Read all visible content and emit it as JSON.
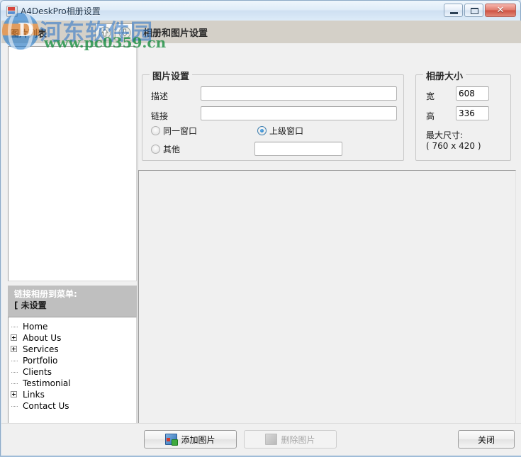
{
  "window": {
    "title": "A4DeskPro相册设置",
    "icon": "app-icon",
    "controls": {
      "minimize": "minimize-icon",
      "maximize": "maximize-icon",
      "close": "✕"
    }
  },
  "toolbar": {
    "left_panel_label": "图片列表",
    "move_up": "arrow-up-icon",
    "move_down": "arrow-down-icon",
    "right_panel_label": "相册和图片设置"
  },
  "left": {
    "image_list_items": [],
    "menu_header": {
      "line1": "链接相册到菜单:",
      "line2": "[ 未设置"
    },
    "tree": [
      {
        "label": "Home",
        "expandable": false
      },
      {
        "label": "About Us",
        "expandable": true
      },
      {
        "label": "Services",
        "expandable": true
      },
      {
        "label": "Portfolio",
        "expandable": false
      },
      {
        "label": "Clients",
        "expandable": false
      },
      {
        "label": "Testimonial",
        "expandable": false
      },
      {
        "label": "Links",
        "expandable": true
      },
      {
        "label": "Contact Us",
        "expandable": false
      }
    ]
  },
  "picture_settings": {
    "title": "图片设置",
    "description_label": "描述",
    "description_value": "",
    "description_placeholder": "",
    "link_label": "链接",
    "link_value": "",
    "link_placeholder": "",
    "radios": [
      {
        "label": "同一窗口",
        "selected": false
      },
      {
        "label": "上级窗口",
        "selected": true
      },
      {
        "label": "其他",
        "selected": false
      }
    ],
    "other_value": "",
    "other_placeholder": ""
  },
  "album_size": {
    "title": "相册大小",
    "width_label": "宽",
    "width_value": "608",
    "height_label": "高",
    "height_value": "336",
    "max_label": "最大尺寸:",
    "max_value": "( 760 x 420 )"
  },
  "footer": {
    "add_image": "添加图片",
    "delete_image": "删除图片",
    "delete_disabled": true,
    "close": "关闭"
  },
  "watermark": {
    "logo_letter": "D",
    "site_name": "河东软件园",
    "url": "www.pc0359.cn"
  },
  "colors": {
    "title_bar": "#dfecf8",
    "toolbar": "#d4d0c8",
    "panel": "#f0f0f0",
    "accent_radio": "#1c6fb5",
    "close_button": "#cf5142",
    "menu_header": "#bfbfbf"
  }
}
